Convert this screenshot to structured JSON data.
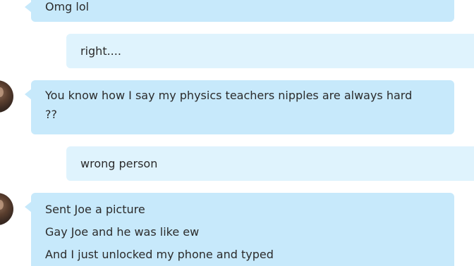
{
  "messages": [
    {
      "direction": "in",
      "lines": [
        "Omg lol"
      ]
    },
    {
      "direction": "out",
      "lines": [
        "right...."
      ]
    },
    {
      "direction": "in",
      "lines": [
        "You know how I say my physics teachers nipples are always hard ??"
      ],
      "avatar": "contact-avatar"
    },
    {
      "direction": "out",
      "lines": [
        "wrong person"
      ]
    },
    {
      "direction": "in",
      "lines": [
        "Sent Joe a picture",
        "Gay Joe and he was like ew",
        "And I just unlocked my phone and typed"
      ],
      "avatar": "contact-avatar"
    }
  ],
  "colors": {
    "incoming_bubble": "#c7e9fb",
    "outgoing_bubble": "#dff3fd",
    "text": "#2b2b2b",
    "background": "#ffffff"
  }
}
